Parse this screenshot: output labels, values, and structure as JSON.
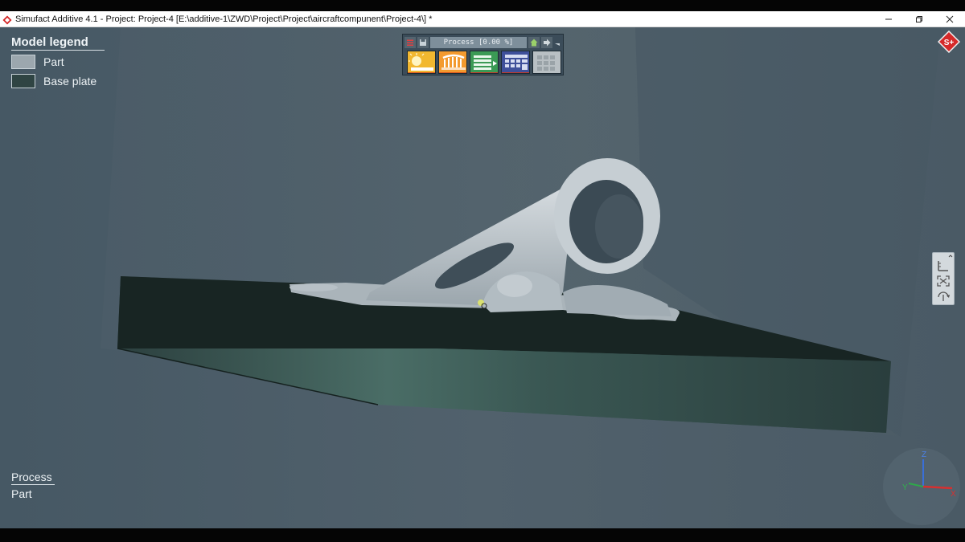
{
  "window": {
    "title": "Simufact Additive 4.1 - Project: Project-4 [E:\\additive-1\\ZWD\\Project\\Project\\aircraftcompunent\\Project-4\\] *",
    "controls": [
      "minimize",
      "restore",
      "close"
    ]
  },
  "legend": {
    "title": "Model legend",
    "items": [
      {
        "label": "Part",
        "color": "#9ca7ae"
      },
      {
        "label": "Base plate",
        "color": "#2f4443"
      }
    ]
  },
  "toolbar": {
    "process_text": "Process [0.00 %]",
    "icons": [
      "build-setup-icon",
      "supports-icon",
      "stages-icon",
      "results-icon",
      "disabled-grid-icon"
    ]
  },
  "process_panel": {
    "title": "Process",
    "subtitle": "Part"
  },
  "triad": {
    "x": "X",
    "y": "Y",
    "z": "Z"
  },
  "colors": {
    "background": "#4b5b66",
    "part": "#b9c2c8",
    "base_plate": "#2f4443",
    "accent": "#cc2222"
  }
}
